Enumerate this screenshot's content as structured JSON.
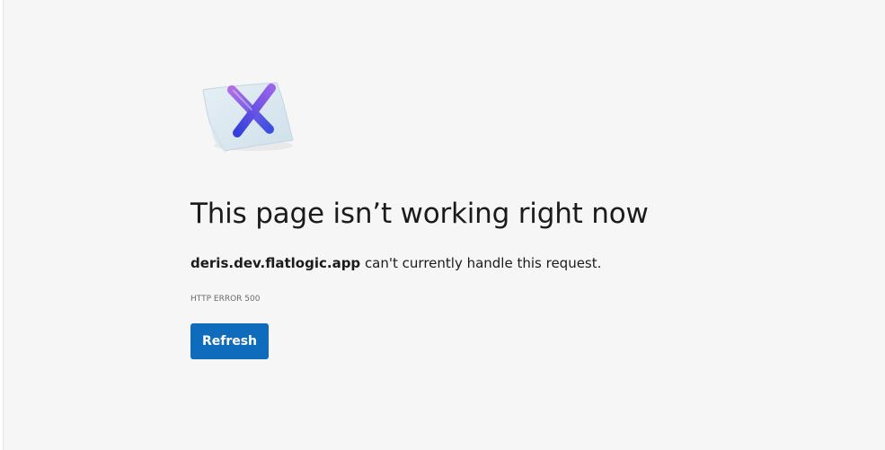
{
  "error_page": {
    "illustration_icon": "x-mark-on-paper-icon",
    "headline": "This page isn’t working right now",
    "host": "deris.dev.flatlogic.app",
    "message_suffix": " can't currently handle this request.",
    "error_code": "HTTP ERROR 500",
    "refresh_label": "Refresh"
  },
  "colors": {
    "background": "#f6f6f6",
    "button_primary": "#0f6cbd",
    "button_text": "#ffffff",
    "text_primary": "#1b1b1b",
    "text_secondary": "#6b6b6b",
    "x_gradient_start": "#a866e8",
    "x_gradient_end": "#3b4fe0"
  }
}
